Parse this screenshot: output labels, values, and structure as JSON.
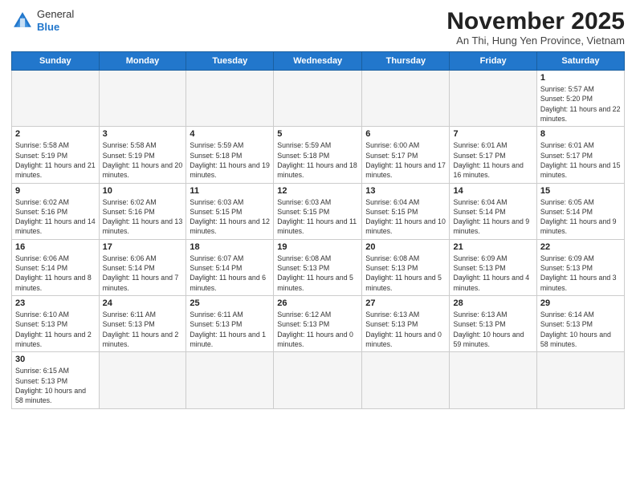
{
  "header": {
    "logo_general": "General",
    "logo_blue": "Blue",
    "month_title": "November 2025",
    "subtitle": "An Thi, Hung Yen Province, Vietnam"
  },
  "weekdays": [
    "Sunday",
    "Monday",
    "Tuesday",
    "Wednesday",
    "Thursday",
    "Friday",
    "Saturday"
  ],
  "weeks": [
    [
      {
        "day": "",
        "empty": true
      },
      {
        "day": "",
        "empty": true
      },
      {
        "day": "",
        "empty": true
      },
      {
        "day": "",
        "empty": true
      },
      {
        "day": "",
        "empty": true
      },
      {
        "day": "",
        "empty": true
      },
      {
        "day": "1",
        "sunrise": "Sunrise: 5:57 AM",
        "sunset": "Sunset: 5:20 PM",
        "daylight": "Daylight: 11 hours and 22 minutes."
      }
    ],
    [
      {
        "day": "2",
        "sunrise": "Sunrise: 5:58 AM",
        "sunset": "Sunset: 5:19 PM",
        "daylight": "Daylight: 11 hours and 21 minutes."
      },
      {
        "day": "3",
        "sunrise": "Sunrise: 5:58 AM",
        "sunset": "Sunset: 5:19 PM",
        "daylight": "Daylight: 11 hours and 20 minutes."
      },
      {
        "day": "4",
        "sunrise": "Sunrise: 5:59 AM",
        "sunset": "Sunset: 5:18 PM",
        "daylight": "Daylight: 11 hours and 19 minutes."
      },
      {
        "day": "5",
        "sunrise": "Sunrise: 5:59 AM",
        "sunset": "Sunset: 5:18 PM",
        "daylight": "Daylight: 11 hours and 18 minutes."
      },
      {
        "day": "6",
        "sunrise": "Sunrise: 6:00 AM",
        "sunset": "Sunset: 5:17 PM",
        "daylight": "Daylight: 11 hours and 17 minutes."
      },
      {
        "day": "7",
        "sunrise": "Sunrise: 6:01 AM",
        "sunset": "Sunset: 5:17 PM",
        "daylight": "Daylight: 11 hours and 16 minutes."
      },
      {
        "day": "8",
        "sunrise": "Sunrise: 6:01 AM",
        "sunset": "Sunset: 5:17 PM",
        "daylight": "Daylight: 11 hours and 15 minutes."
      }
    ],
    [
      {
        "day": "9",
        "sunrise": "Sunrise: 6:02 AM",
        "sunset": "Sunset: 5:16 PM",
        "daylight": "Daylight: 11 hours and 14 minutes."
      },
      {
        "day": "10",
        "sunrise": "Sunrise: 6:02 AM",
        "sunset": "Sunset: 5:16 PM",
        "daylight": "Daylight: 11 hours and 13 minutes."
      },
      {
        "day": "11",
        "sunrise": "Sunrise: 6:03 AM",
        "sunset": "Sunset: 5:15 PM",
        "daylight": "Daylight: 11 hours and 12 minutes."
      },
      {
        "day": "12",
        "sunrise": "Sunrise: 6:03 AM",
        "sunset": "Sunset: 5:15 PM",
        "daylight": "Daylight: 11 hours and 11 minutes."
      },
      {
        "day": "13",
        "sunrise": "Sunrise: 6:04 AM",
        "sunset": "Sunset: 5:15 PM",
        "daylight": "Daylight: 11 hours and 10 minutes."
      },
      {
        "day": "14",
        "sunrise": "Sunrise: 6:04 AM",
        "sunset": "Sunset: 5:14 PM",
        "daylight": "Daylight: 11 hours and 9 minutes."
      },
      {
        "day": "15",
        "sunrise": "Sunrise: 6:05 AM",
        "sunset": "Sunset: 5:14 PM",
        "daylight": "Daylight: 11 hours and 9 minutes."
      }
    ],
    [
      {
        "day": "16",
        "sunrise": "Sunrise: 6:06 AM",
        "sunset": "Sunset: 5:14 PM",
        "daylight": "Daylight: 11 hours and 8 minutes."
      },
      {
        "day": "17",
        "sunrise": "Sunrise: 6:06 AM",
        "sunset": "Sunset: 5:14 PM",
        "daylight": "Daylight: 11 hours and 7 minutes."
      },
      {
        "day": "18",
        "sunrise": "Sunrise: 6:07 AM",
        "sunset": "Sunset: 5:14 PM",
        "daylight": "Daylight: 11 hours and 6 minutes."
      },
      {
        "day": "19",
        "sunrise": "Sunrise: 6:08 AM",
        "sunset": "Sunset: 5:13 PM",
        "daylight": "Daylight: 11 hours and 5 minutes."
      },
      {
        "day": "20",
        "sunrise": "Sunrise: 6:08 AM",
        "sunset": "Sunset: 5:13 PM",
        "daylight": "Daylight: 11 hours and 5 minutes."
      },
      {
        "day": "21",
        "sunrise": "Sunrise: 6:09 AM",
        "sunset": "Sunset: 5:13 PM",
        "daylight": "Daylight: 11 hours and 4 minutes."
      },
      {
        "day": "22",
        "sunrise": "Sunrise: 6:09 AM",
        "sunset": "Sunset: 5:13 PM",
        "daylight": "Daylight: 11 hours and 3 minutes."
      }
    ],
    [
      {
        "day": "23",
        "sunrise": "Sunrise: 6:10 AM",
        "sunset": "Sunset: 5:13 PM",
        "daylight": "Daylight: 11 hours and 2 minutes."
      },
      {
        "day": "24",
        "sunrise": "Sunrise: 6:11 AM",
        "sunset": "Sunset: 5:13 PM",
        "daylight": "Daylight: 11 hours and 2 minutes."
      },
      {
        "day": "25",
        "sunrise": "Sunrise: 6:11 AM",
        "sunset": "Sunset: 5:13 PM",
        "daylight": "Daylight: 11 hours and 1 minute."
      },
      {
        "day": "26",
        "sunrise": "Sunrise: 6:12 AM",
        "sunset": "Sunset: 5:13 PM",
        "daylight": "Daylight: 11 hours and 0 minutes."
      },
      {
        "day": "27",
        "sunrise": "Sunrise: 6:13 AM",
        "sunset": "Sunset: 5:13 PM",
        "daylight": "Daylight: 11 hours and 0 minutes."
      },
      {
        "day": "28",
        "sunrise": "Sunrise: 6:13 AM",
        "sunset": "Sunset: 5:13 PM",
        "daylight": "Daylight: 10 hours and 59 minutes."
      },
      {
        "day": "29",
        "sunrise": "Sunrise: 6:14 AM",
        "sunset": "Sunset: 5:13 PM",
        "daylight": "Daylight: 10 hours and 58 minutes."
      }
    ],
    [
      {
        "day": "30",
        "sunrise": "Sunrise: 6:15 AM",
        "sunset": "Sunset: 5:13 PM",
        "daylight": "Daylight: 10 hours and 58 minutes."
      },
      {
        "day": "",
        "empty": true
      },
      {
        "day": "",
        "empty": true
      },
      {
        "day": "",
        "empty": true
      },
      {
        "day": "",
        "empty": true
      },
      {
        "day": "",
        "empty": true
      },
      {
        "day": "",
        "empty": true
      }
    ]
  ]
}
